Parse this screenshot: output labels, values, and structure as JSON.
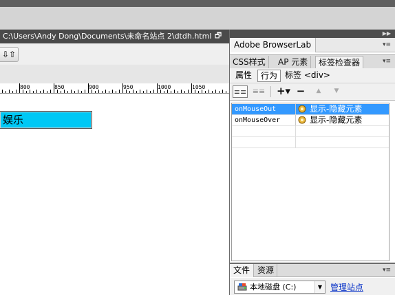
{
  "document": {
    "path": "C:\\Users\\Andy Dong\\Documents\\未命名站点 2\\dtdh.html",
    "restore_icon": "restore-window-icon",
    "toolbar_button_icon": "file-management-icon",
    "toolbar_button_glyph": "⇩⇧",
    "ruler_labels": [
      "800",
      "850",
      "900",
      "950",
      "1000",
      "1050"
    ],
    "div_text": "娱乐",
    "div_color": "#00c8f5"
  },
  "panel": {
    "collapse_glyph": "▶▶",
    "browserlab_title": "Adobe BrowserLab",
    "menu_glyph": "▾≡",
    "tabs": [
      "CSS样式",
      "AP 元素",
      "标签检查器"
    ],
    "subtabs": [
      "属性",
      "行为"
    ],
    "tag_label": "标签 <div>",
    "toolbar": {
      "show_set_glyph": "≡≡",
      "show_all_glyph": "≡≡",
      "add_glyph": "+▾",
      "remove_glyph": "−",
      "up_glyph": "▲",
      "down_glyph": "▼"
    },
    "behaviors": [
      {
        "event": "onMouseOut",
        "action": "显示-隐藏元素",
        "selected": true
      },
      {
        "event": "onMouseOver",
        "action": "显示-隐藏元素",
        "selected": false
      }
    ],
    "selection_color": "#3399ff"
  },
  "files": {
    "tabs": [
      "文件",
      "资源"
    ],
    "drive": "本地磁盘 (C:)",
    "drive_arrow": "▼",
    "manage_sites": "管理站点",
    "link_color": "#0b35c8"
  }
}
